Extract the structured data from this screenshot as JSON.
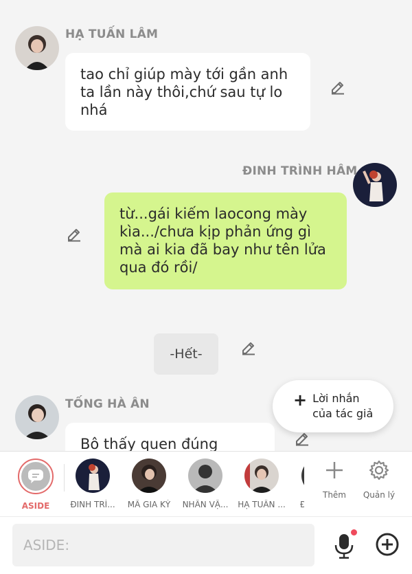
{
  "messages": [
    {
      "sender": "HẠ TUẤN LÂM",
      "text": "tao chỉ giúp mày tới gần anh ta lần này thôi,chứ sau tự lo nhá"
    },
    {
      "sender": "ĐINH TRÌNH HÂM",
      "text": "từ...gái kiếm laocong mày kìa.../chưa kịp phản ứng gì mà ai kia đã bay như tên lửa qua đó rồi/"
    },
    {
      "system_text": "-Hết-"
    },
    {
      "sender": "TỐNG HÀ ÂN",
      "text": "Bô thấy quen đúng không"
    }
  ],
  "author_note": {
    "label": "Lời nhắn của tác giả"
  },
  "characters": [
    {
      "label": "ASIDE"
    },
    {
      "label": "ĐINH TRÌ..."
    },
    {
      "label": "MÃ GIA KỲ"
    },
    {
      "label": "NHÂN VẬ..."
    },
    {
      "label": "HẠ TUẤN ..."
    },
    {
      "label": "Đ"
    }
  ],
  "tools": {
    "add_label": "Thêm",
    "manage_label": "Quản lý"
  },
  "input": {
    "placeholder": "ASIDE:"
  },
  "colors": {
    "accent": "#e36a6a",
    "bubble_green": "#d5f58e",
    "mic_dot": "#ef4a5c"
  }
}
